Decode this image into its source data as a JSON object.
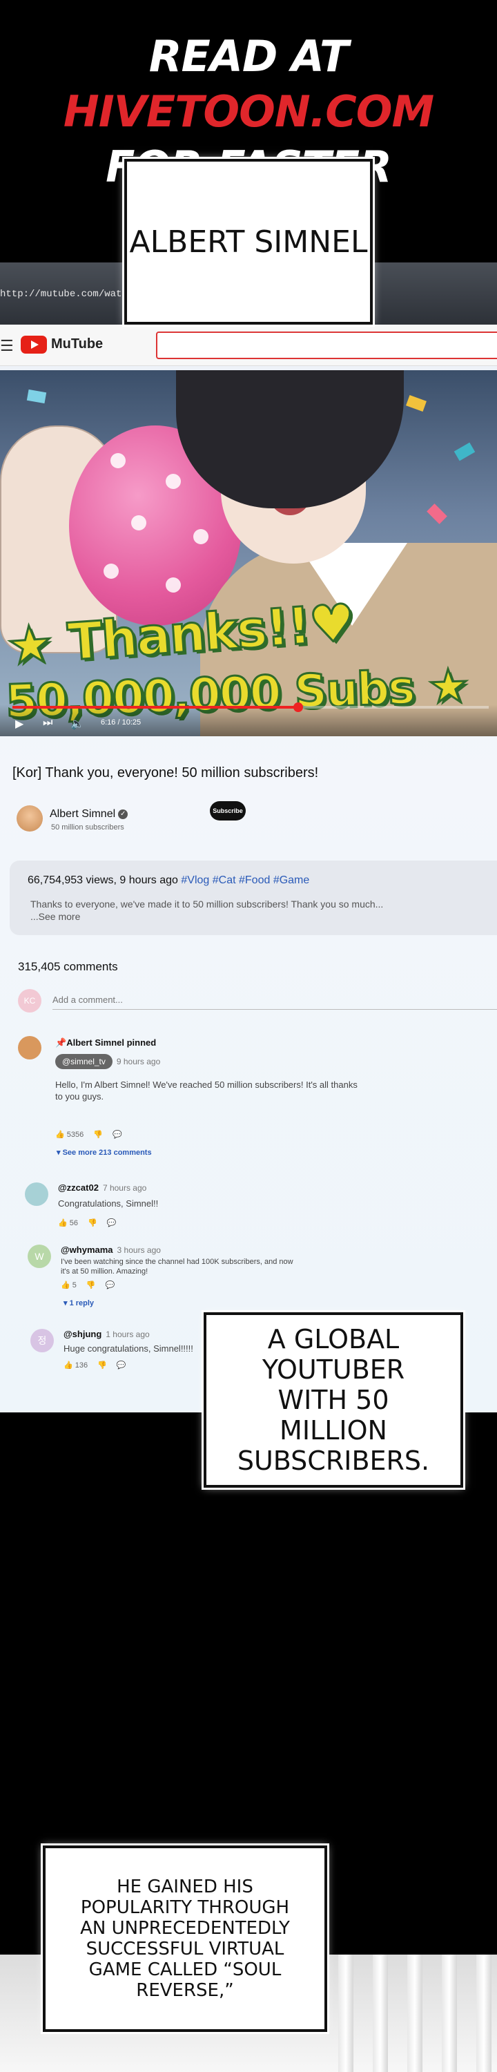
{
  "banner": {
    "line1_prefix": "READ AT ",
    "line1_site": "HIVETOON.COM",
    "line2": "FOR FASTER UPDATES!"
  },
  "captions": {
    "name": "ALBERT SIMNEL",
    "youtuber": "A GLOBAL YOUTUBER WITH 50 MILLION SUBSCRIBERS.",
    "popularity": "HE GAINED HIS POPULARITY THROUGH AN UNPRECEDENTEDLY SUCCESSFUL VIRTUAL GAME CALLED “SOUL REVERSE,”"
  },
  "browser": {
    "url": "http://mutube.com/watch?v",
    "brand": "MuTube",
    "menu_icon": "hamburger-icon",
    "logo_color": "#e62117"
  },
  "video": {
    "overlay_line1": "★ Thanks!!♥",
    "overlay_line2": "50,000,000 Subs ★",
    "time": "6:16 / 10:25",
    "progress_fraction": 0.6,
    "play_icon": "play-icon",
    "next_icon": "next-icon",
    "volume_icon": "volume-icon"
  },
  "watch": {
    "title": "[Kor] Thank you, everyone! 50 million subscribers!",
    "channel_name": "Albert Simnel",
    "channel_subs": "50 million subscribers",
    "subscribe_label": "Subscribe",
    "views_line": "66,754,953 views, 9 hours ago",
    "tags": "#Vlog #Cat #Food #Game",
    "description": "Thanks to everyone, we've made it to 50 million subscribers! Thank you so much...",
    "see_more": "...See more",
    "comment_count": "315,405 comments",
    "add_comment_placeholder": "Add a comment...",
    "add_avatar_text": "KC"
  },
  "comments": [
    {
      "pinned_label": "Albert Simnel pinned",
      "author": "@simnel_tv",
      "time": "9 hours ago",
      "text": "Hello, I'm Albert Simnel! We've reached 50 million subscribers! It's all thanks to you guys.",
      "likes": "5356",
      "replies_link": "See more 213 comments",
      "avatar_color": "#d9985d"
    },
    {
      "author": "@zzcat02",
      "time": "7 hours ago",
      "text": "Congratulations, Simnel!!",
      "likes": "56",
      "avatar_color": "#a7d1d6"
    },
    {
      "author": "@whymama",
      "time": "3 hours ago",
      "text": "I've been watching since the channel had 100K subscribers, and now it's at 50 million. Amazing!",
      "likes": "5",
      "avatar_text": "W",
      "replies_link": "1 reply",
      "avatar_color": "#b8d8a8"
    },
    {
      "author": "@shjung",
      "time": "1 hours ago",
      "text": "Huge congratulations, Simnel!!!!!",
      "likes": "136",
      "avatar_text": "정",
      "avatar_color": "#d8c4e4"
    }
  ]
}
